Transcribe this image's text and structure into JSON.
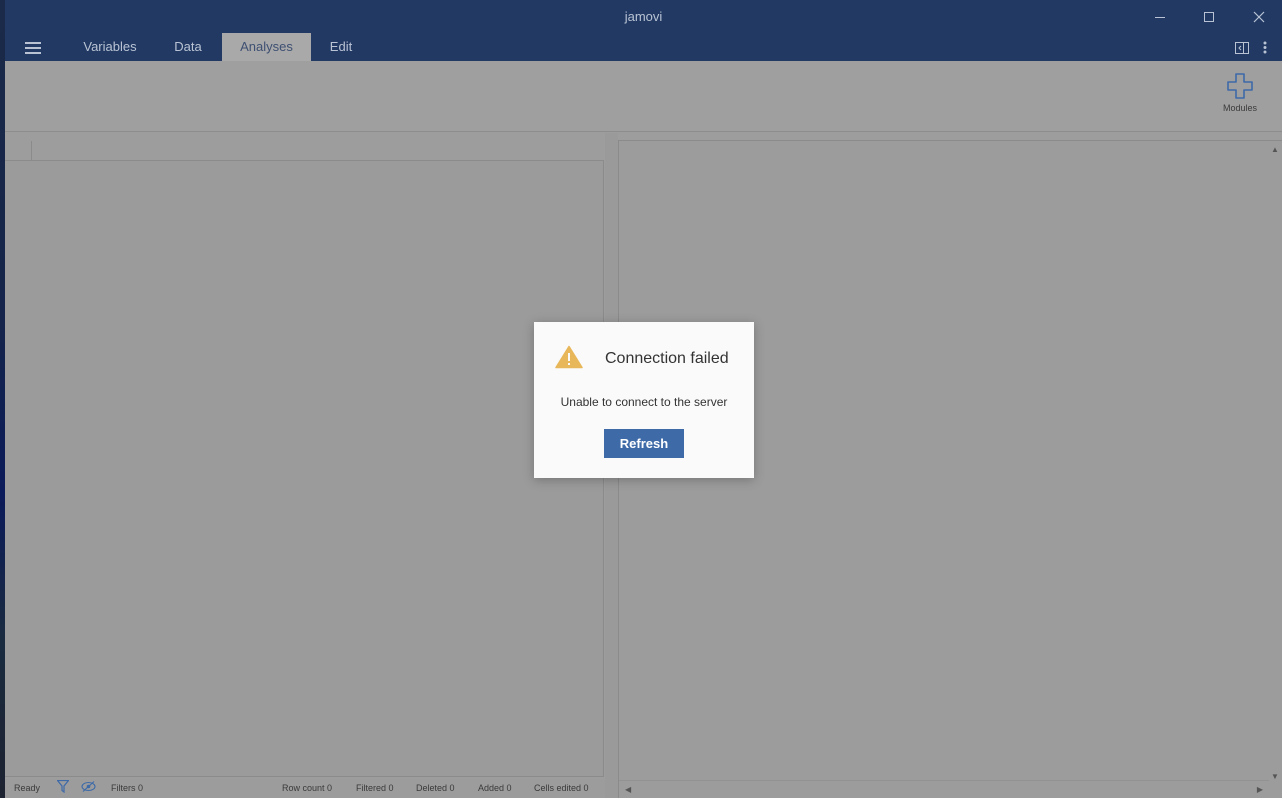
{
  "window": {
    "title": "jamovi"
  },
  "tabs": [
    {
      "label": "Variables"
    },
    {
      "label": "Data"
    },
    {
      "label": "Analyses",
      "active": true
    },
    {
      "label": "Edit"
    }
  ],
  "ribbon": {
    "modules_label": "Modules"
  },
  "statusbar": {
    "ready": "Ready",
    "filters": "Filters 0",
    "row_count": "Row count 0",
    "filtered": "Filtered 0",
    "deleted": "Deleted 0",
    "added": "Added 0",
    "cells_edited": "Cells edited 0"
  },
  "dialog": {
    "title": "Connection failed",
    "message": "Unable to connect to the server",
    "button": "Refresh"
  },
  "icons": {
    "menu": "hamburger-icon",
    "minimize": "minimize-icon",
    "maximize": "maximize-icon",
    "close": "close-icon",
    "panel_toggle": "panel-toggle-icon",
    "more": "more-vertical-icon",
    "modules": "plus-icon",
    "filter": "filter-icon",
    "visibility": "eye-slash-icon",
    "warning": "warning-icon"
  },
  "colors": {
    "titlebar": "#223a63",
    "accent": "#3e6aa8",
    "warning": "#e8b75a"
  }
}
